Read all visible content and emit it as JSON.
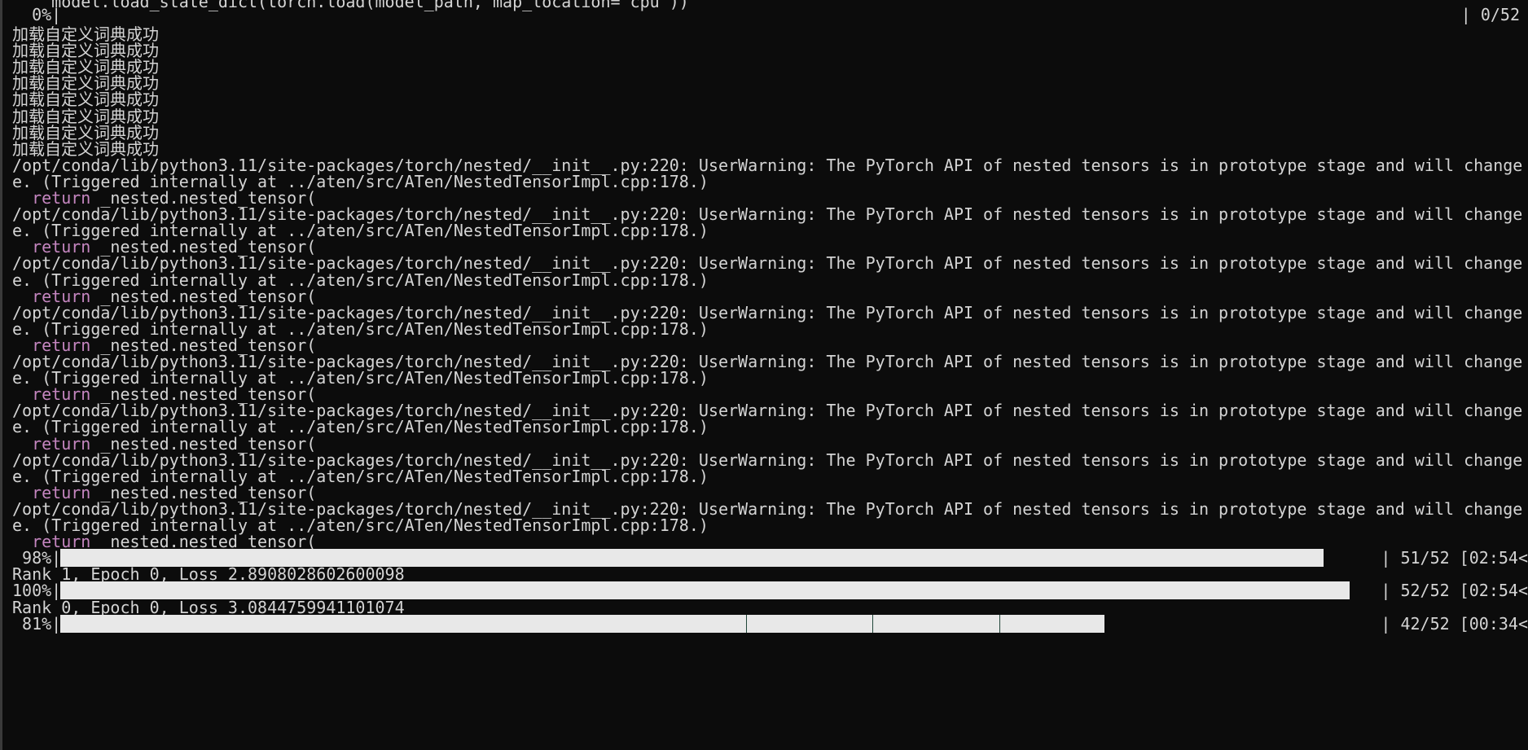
{
  "top_partial": "    model.load_state_dict(torch.load(model_path, map_location='cpu'))",
  "progress_start": {
    "percent": "  0%|",
    "count": "| 0/52"
  },
  "dict_msg": "加载自定义词典成功",
  "dict_repeat": 8,
  "warning": {
    "line1": "/opt/conda/lib/python3.11/site-packages/torch/nested/__init__.py:220: UserWarning: The PyTorch API of nested tensors is in prototype stage and will change",
    "line2": "e. (Triggered internally at ../aten/src/ATen/NestedTensorImpl.cpp:178.)",
    "ret_kw": "return",
    "ret_rest": " _nested.nested_tensor("
  },
  "warning_repeat": 8,
  "bars": [
    {
      "percent": " 98%|",
      "fill": 0.98,
      "count": "| 51/52 [02:54<",
      "after": "Rank 1, Epoch 0, Loss 2.8908028602600098"
    },
    {
      "percent": "100%|",
      "fill": 1.0,
      "count": "| 52/52 [02:54<",
      "after": "Rank 0, Epoch 0, Loss 3.0844759941101074"
    },
    {
      "percent": " 81%|",
      "fill": 0.81,
      "count": "| 42/52 [00:34<",
      "after": ""
    }
  ]
}
